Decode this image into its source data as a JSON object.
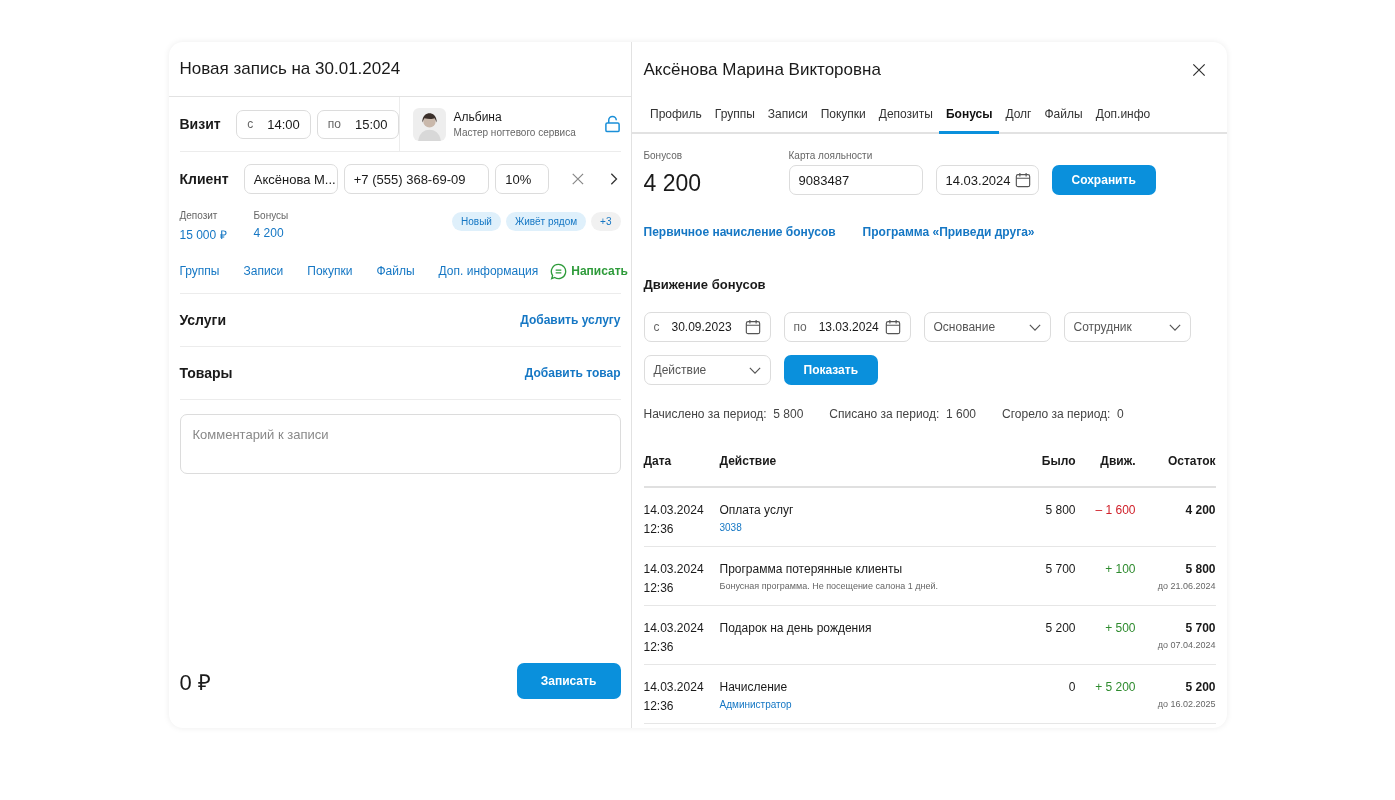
{
  "booking": {
    "title": "Новая запись на 30.01.2024",
    "visit": {
      "label": "Визит",
      "from_prefix": "с",
      "from": "14:00",
      "to_prefix": "по",
      "to": "15:00"
    },
    "master": {
      "name": "Альбина",
      "role": "Мастер ногтевого сервиса",
      "locked": false
    },
    "client": {
      "label": "Клиент",
      "name": "Аксёнова М...",
      "phone": "+7 (555) 368-69-09",
      "discount": "10%"
    },
    "balances": [
      {
        "label": "Депозит",
        "value": "15 000 ₽"
      },
      {
        "label": "Бонусы",
        "value": "4 200"
      }
    ],
    "tags": [
      {
        "text": "Новый",
        "kind": "tag"
      },
      {
        "text": "Живёт рядом",
        "kind": "tag"
      },
      {
        "text": "+3",
        "kind": "more"
      }
    ],
    "links": [
      "Группы",
      "Записи",
      "Покупки",
      "Файлы",
      "Доп. информация"
    ],
    "message_button": "Написать",
    "sections": [
      {
        "label": "Услуги",
        "action": "Добавить услугу"
      },
      {
        "label": "Товары",
        "action": "Добавить товар"
      }
    ],
    "comment": {
      "placeholder": "Комментарий к записи"
    },
    "total": "0 ₽",
    "submit": "Записать"
  },
  "client_card": {
    "title": "Аксёнова Марина Викторовна",
    "tabs": [
      {
        "label": "Профиль",
        "selected": false
      },
      {
        "label": "Группы",
        "selected": false
      },
      {
        "label": "Записи",
        "selected": false
      },
      {
        "label": "Покупки",
        "selected": false
      },
      {
        "label": "Депозиты",
        "selected": false
      },
      {
        "label": "Бонусы",
        "selected": true
      },
      {
        "label": "Долг",
        "selected": false
      },
      {
        "label": "Файлы",
        "selected": false
      },
      {
        "label": "Доп.инфо",
        "selected": false
      }
    ],
    "bonus": {
      "label": "Бонусов",
      "value": "4 200"
    },
    "loyalty": {
      "label": "Карта лояльности",
      "card": "9083487",
      "date": "14.03.2024"
    },
    "save": "Сохранить",
    "links": [
      "Первичное начисление бонусов",
      "Программа «Приведи друга»"
    ],
    "movement_title": "Движение бонусов",
    "filters": [
      {
        "kind": "date",
        "prefix": "с",
        "value": "30.09.2023"
      },
      {
        "kind": "date",
        "prefix": "по",
        "value": "13.03.2024"
      },
      {
        "kind": "select",
        "value": "Основание"
      },
      {
        "kind": "select",
        "value": "Сотрудник"
      },
      {
        "kind": "select",
        "value": "Действие"
      }
    ],
    "show": "Показать",
    "summary": [
      {
        "label": "Начислено за период:",
        "value": "5 800"
      },
      {
        "label": "Списано за период:",
        "value": "1 600"
      },
      {
        "label": "Сгорело за период:",
        "value": "0"
      }
    ],
    "columns": [
      "Дата",
      "Действие",
      "Было",
      "Движ.",
      "Остаток"
    ],
    "rows": [
      {
        "kind": "debit",
        "date": "14.03.2024",
        "time": "12:36",
        "action": "Оплата услуг",
        "sub": {
          "kind": "link",
          "text": "3038"
        },
        "was": "5 800",
        "move": "– 1 600",
        "balance": "4 200"
      },
      {
        "kind": "credit",
        "date": "14.03.2024",
        "time": "12:36",
        "action": "Программа потерянные клиенты",
        "sub": {
          "kind": "note",
          "text": "Бонусная программа. Не посещение салона 1 дней."
        },
        "was": "5 700",
        "move": "+ 100",
        "balance": "5 800",
        "until": "до 21.06.2024"
      },
      {
        "kind": "credit",
        "date": "14.03.2024",
        "time": "12:36",
        "action": "Подарок на день рождения",
        "was": "5 200",
        "move": "+ 500",
        "balance": "5 700",
        "until": "до 07.04.2024"
      },
      {
        "kind": "credit",
        "date": "14.03.2024",
        "time": "12:36",
        "action": "Начисление",
        "sub": {
          "kind": "link",
          "text": "Администратор"
        },
        "was": "0",
        "move": "+ 5 200",
        "balance": "5 200",
        "until": "до 16.02.2025"
      }
    ]
  }
}
